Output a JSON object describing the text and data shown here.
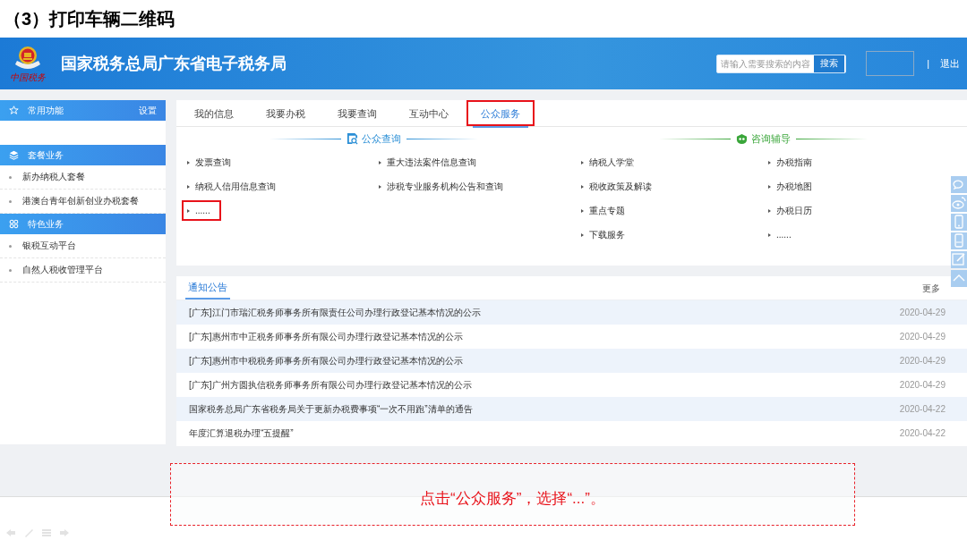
{
  "slide_title": "（3）打印车辆二维码",
  "header": {
    "logo_caption": "中国税务",
    "title": "国家税务总局广东省电子税务局",
    "search": {
      "placeholder": "请输入需要搜索的内容",
      "button": "搜索"
    },
    "separator": "|",
    "logout": "退出"
  },
  "sidebar": {
    "sections": [
      {
        "title": "常用功能",
        "action": "设置"
      },
      {
        "title": "套餐业务",
        "items": [
          "新办纳税人套餐",
          "港澳台青年创新创业办税套餐"
        ]
      },
      {
        "title": "特色业务",
        "items": [
          "银税互动平台",
          "自然人税收管理平台"
        ]
      }
    ]
  },
  "tabs": [
    {
      "label": "我的信息",
      "selected": false,
      "highlighted": false
    },
    {
      "label": "我要办税",
      "selected": false,
      "highlighted": false
    },
    {
      "label": "我要查询",
      "selected": false,
      "highlighted": false
    },
    {
      "label": "互动中心",
      "selected": false,
      "highlighted": false
    },
    {
      "label": "公众服务",
      "selected": true,
      "highlighted": true
    }
  ],
  "service_groups": [
    {
      "title": "公众查询",
      "color": "#2b8fd6",
      "items": [
        {
          "label": "发票查询",
          "highlighted": false
        },
        {
          "label": "重大违法案件信息查询",
          "highlighted": false
        },
        {
          "label": "纳税人信用信息查询",
          "highlighted": false
        },
        {
          "label": "涉税专业服务机构公告和查询",
          "highlighted": false
        },
        {
          "label": "......",
          "highlighted": true
        }
      ]
    },
    {
      "title": "咨询辅导",
      "color": "#3aa63a",
      "items": [
        {
          "label": "纳税人学堂",
          "highlighted": false
        },
        {
          "label": "办税指南",
          "highlighted": false
        },
        {
          "label": "税收政策及解读",
          "highlighted": false
        },
        {
          "label": "办税地图",
          "highlighted": false
        },
        {
          "label": "重点专题",
          "highlighted": false
        },
        {
          "label": "办税日历",
          "highlighted": false
        },
        {
          "label": "下载服务",
          "highlighted": false
        },
        {
          "label": "......",
          "highlighted": false
        }
      ]
    }
  ],
  "notices": {
    "tab": "通知公告",
    "more": "更多",
    "rows": [
      {
        "title": "[广东]江门市瑞汇税务师事务所有限责任公司办理行政登记基本情况的公示",
        "date": "2020-04-29"
      },
      {
        "title": "[广东]惠州市中正税务师事务所有限公司办理行政登记基本情况的公示",
        "date": "2020-04-29"
      },
      {
        "title": "[广东]惠州市中税税务师事务所有限公司办理行政登记基本情况的公示",
        "date": "2020-04-29"
      },
      {
        "title": "[广东]广州方圆执信税务师事务所有限公司办理行政登记基本情况的公示",
        "date": "2020-04-29"
      },
      {
        "title": "国家税务总局广东省税务局关于更新办税费事项“一次不用跑”清单的通告",
        "date": "2020-04-22"
      },
      {
        "title": "年度汇算退税办理“五提醒”",
        "date": "2020-04-22"
      }
    ]
  },
  "callout": "点击“公众服务”，选择“...”。"
}
